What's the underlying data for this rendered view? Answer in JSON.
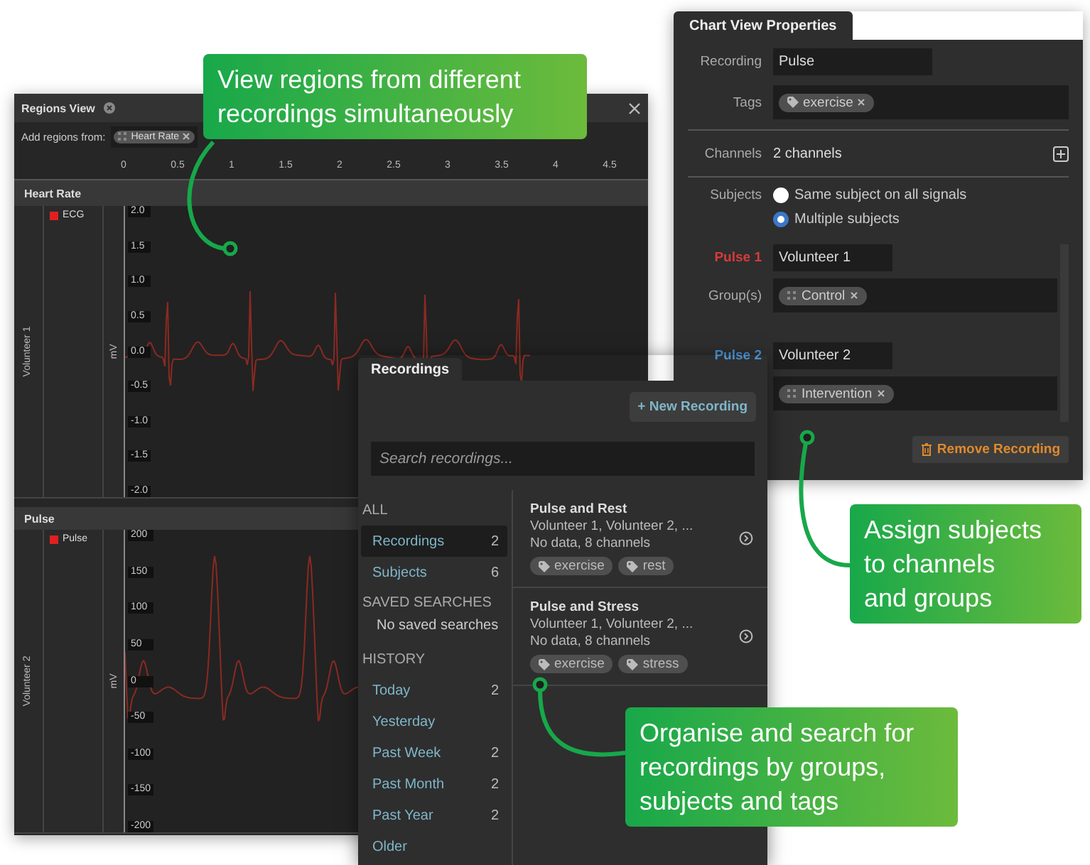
{
  "regions_view": {
    "title": "Regions View",
    "add_label": "Add regions from:",
    "sources": [
      {
        "label": "Heart Rate"
      }
    ],
    "x_ticks": [
      "0",
      "0.5",
      "1",
      "1.5",
      "2",
      "2.5",
      "3",
      "3.5",
      "4",
      "4.5"
    ],
    "tracks": [
      {
        "title": "Heart Rate",
        "subject": "Volunteer 1",
        "legend": "ECG",
        "unit": "mV",
        "kind": "ecg",
        "y_ticks": [
          "2.0",
          "1.5",
          "1.0",
          "0.5",
          "0.0",
          "-0.5",
          "-1.0",
          "-1.5",
          "-2.0"
        ]
      },
      {
        "title": "Pulse",
        "subject": "Volunteer 2",
        "legend": "Pulse",
        "unit": "mV",
        "kind": "pulse",
        "y_ticks": [
          "200",
          "150",
          "100",
          "50",
          "0",
          "-50",
          "-100",
          "-150",
          "-200"
        ]
      }
    ]
  },
  "recordings": {
    "tab": "Recordings",
    "new_button": "+ New Recording",
    "search": {
      "placeholder": "Search recordings..."
    },
    "sections": [
      {
        "heading": "ALL",
        "items": [
          {
            "label": "Recordings",
            "count": "2",
            "selected": true
          },
          {
            "label": "Subjects",
            "count": "6",
            "selected": false
          }
        ]
      },
      {
        "heading": "SAVED SEARCHES",
        "empty": "No saved searches"
      },
      {
        "heading": "HISTORY",
        "items": [
          {
            "label": "Today",
            "count": "2",
            "selected": false
          },
          {
            "label": "Yesterday",
            "selected": false
          },
          {
            "label": "Past Week",
            "count": "2",
            "selected": false
          },
          {
            "label": "Past Month",
            "count": "2",
            "selected": false
          },
          {
            "label": "Past Year",
            "count": "2",
            "selected": false
          },
          {
            "label": "Older",
            "selected": false
          }
        ]
      }
    ],
    "results": [
      {
        "title": "Pulse and Rest",
        "subjects": "Volunteer 1, Volunteer 2, ...",
        "info": "No data, 8 channels",
        "tags": [
          "exercise",
          "rest"
        ]
      },
      {
        "title": "Pulse and Stress",
        "subjects": "Volunteer 1, Volunteer 2, ...",
        "info": "No data, 8 channels",
        "tags": [
          "exercise",
          "stress"
        ]
      }
    ]
  },
  "properties": {
    "tab": "Chart View Properties",
    "recording_label": "Recording",
    "recording": "Pulse",
    "tags_label": "Tags",
    "tags": [
      "exercise"
    ],
    "channels_label": "Channels",
    "channels": "2 channels",
    "subjects_label": "Subjects",
    "subject_options": [
      {
        "label": "Same subject on all signals",
        "selected": false
      },
      {
        "label": "Multiple subjects",
        "selected": true
      }
    ],
    "signals": [
      {
        "name": "Pulse 1",
        "color": "#d83a3a",
        "subject": "Volunteer 1",
        "groups_label": "Group(s)",
        "groups": [
          "Control"
        ]
      },
      {
        "name": "Pulse 2",
        "color": "#4a90d0",
        "subject": "Volunteer 2",
        "groups": [
          "Intervention"
        ]
      }
    ],
    "remove_button": "Remove Recording"
  },
  "callouts": [
    {
      "text": "View regions from different\nrecordings simultaneously"
    },
    {
      "text": "Assign subjects\nto channels\nand groups"
    },
    {
      "text": "Organise and search for\nrecordings by groups,\nsubjects and tags"
    }
  ]
}
